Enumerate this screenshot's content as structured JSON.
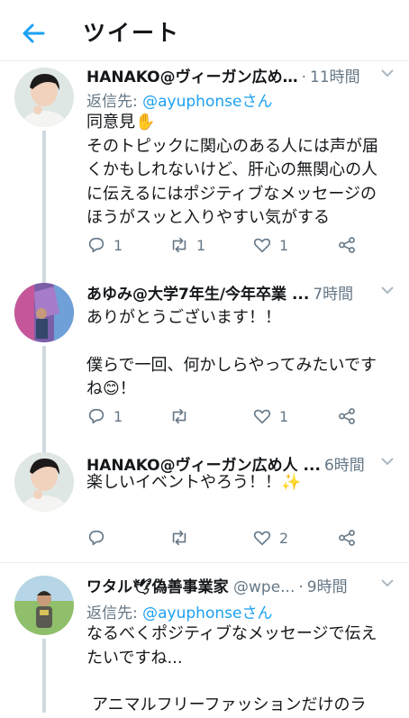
{
  "header": {
    "title": "ツイート",
    "back_icon": "arrow-left-icon"
  },
  "colors": {
    "accent": "#1da1f2",
    "muted": "#657786",
    "text": "#14171a"
  },
  "tweets": [
    {
      "name": "HANAKO@ヴィーガン広め…",
      "handle": "",
      "time": "11時間",
      "reply_prefix": "返信先: ",
      "reply_to": "@ayuphonseさん",
      "lines": [
        "同意見✋",
        "そのトピックに関心のある人には声が届",
        "くかもしれないけど、肝心の無関心の人",
        "に伝えるにはポジティブなメッセージの",
        "ほうがスッと入りやすい気がする"
      ],
      "reply_count": "1",
      "retweet_count": "1",
      "like_count": "1"
    },
    {
      "name": "あゆみ@大学7年生/今年卒業 ...",
      "handle": "",
      "time": "7時間",
      "lines": [
        "ありがとうございます！！",
        "",
        "僕らで一回、何かしらやってみたいです",
        "ね😊！"
      ],
      "reply_count": "1",
      "retweet_count": "",
      "like_count": "1"
    },
    {
      "name": "HANAKO@ヴィーガン広め人 ...",
      "handle": "",
      "time": "6時間",
      "lines": [
        "楽しいイベントやろう！！✨"
      ],
      "reply_count": "",
      "retweet_count": "",
      "like_count": "2"
    },
    {
      "name": "ワタル🕊偽善事業家",
      "handle": "@wpe...",
      "time": "9時間",
      "reply_prefix": "返信先: ",
      "reply_to": "@ayuphonseさん",
      "lines": [
        "なるべくポジティブなメッセージで伝え",
        "たいですね...",
        "",
        "アニマルフリーファッションだけのラ"
      ]
    }
  ]
}
